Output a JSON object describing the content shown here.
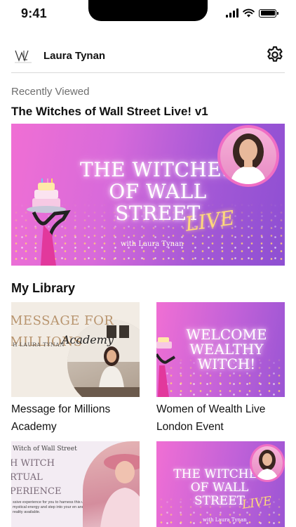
{
  "status_bar": {
    "time": "9:41"
  },
  "header": {
    "user_name": "Laura Tynan",
    "logo_icon": "lt-monogram-logo",
    "settings_icon": "gear-icon"
  },
  "recently_viewed": {
    "section_label": "Recently Viewed",
    "title": "The Witches of Wall Street Live! v1",
    "thumbnail": {
      "title_lines": [
        "THE WITCHES",
        "OF WALL",
        "STREET"
      ],
      "live": "LIVE",
      "subtitle": "with Laura Tynan"
    }
  },
  "library": {
    "title": "My Library",
    "items": [
      {
        "caption": "Message for Millions Academy",
        "thumbnail": {
          "line1": "MESSAGE FOR",
          "line2": "MILLIONS",
          "byline": "H LAURA TYNAN",
          "script": "Academy"
        }
      },
      {
        "caption": "Women of Wealth Live London Event",
        "thumbnail": {
          "lines": [
            "WELCOME",
            "WEALTHY",
            "WITCH!"
          ]
        }
      },
      {
        "caption": "",
        "thumbnail": {
          "small": "Witch of Wall Street",
          "lines": [
            "H WITCH",
            "RTUAL",
            "PERIENCE"
          ],
          "body": "ssive experience for you to harness this ur mystical energy and step into your en and reality available."
        }
      },
      {
        "caption": "",
        "thumbnail": {
          "lines": [
            "THE WITCHES",
            "OF WALL",
            "STREET"
          ],
          "live": "LIVE",
          "subtitle": "with Laura Tynan"
        }
      }
    ]
  },
  "colors": {
    "accent_pink": "#f06fd4",
    "accent_purple": "#9a55d4",
    "gold": "#ffd97a"
  }
}
